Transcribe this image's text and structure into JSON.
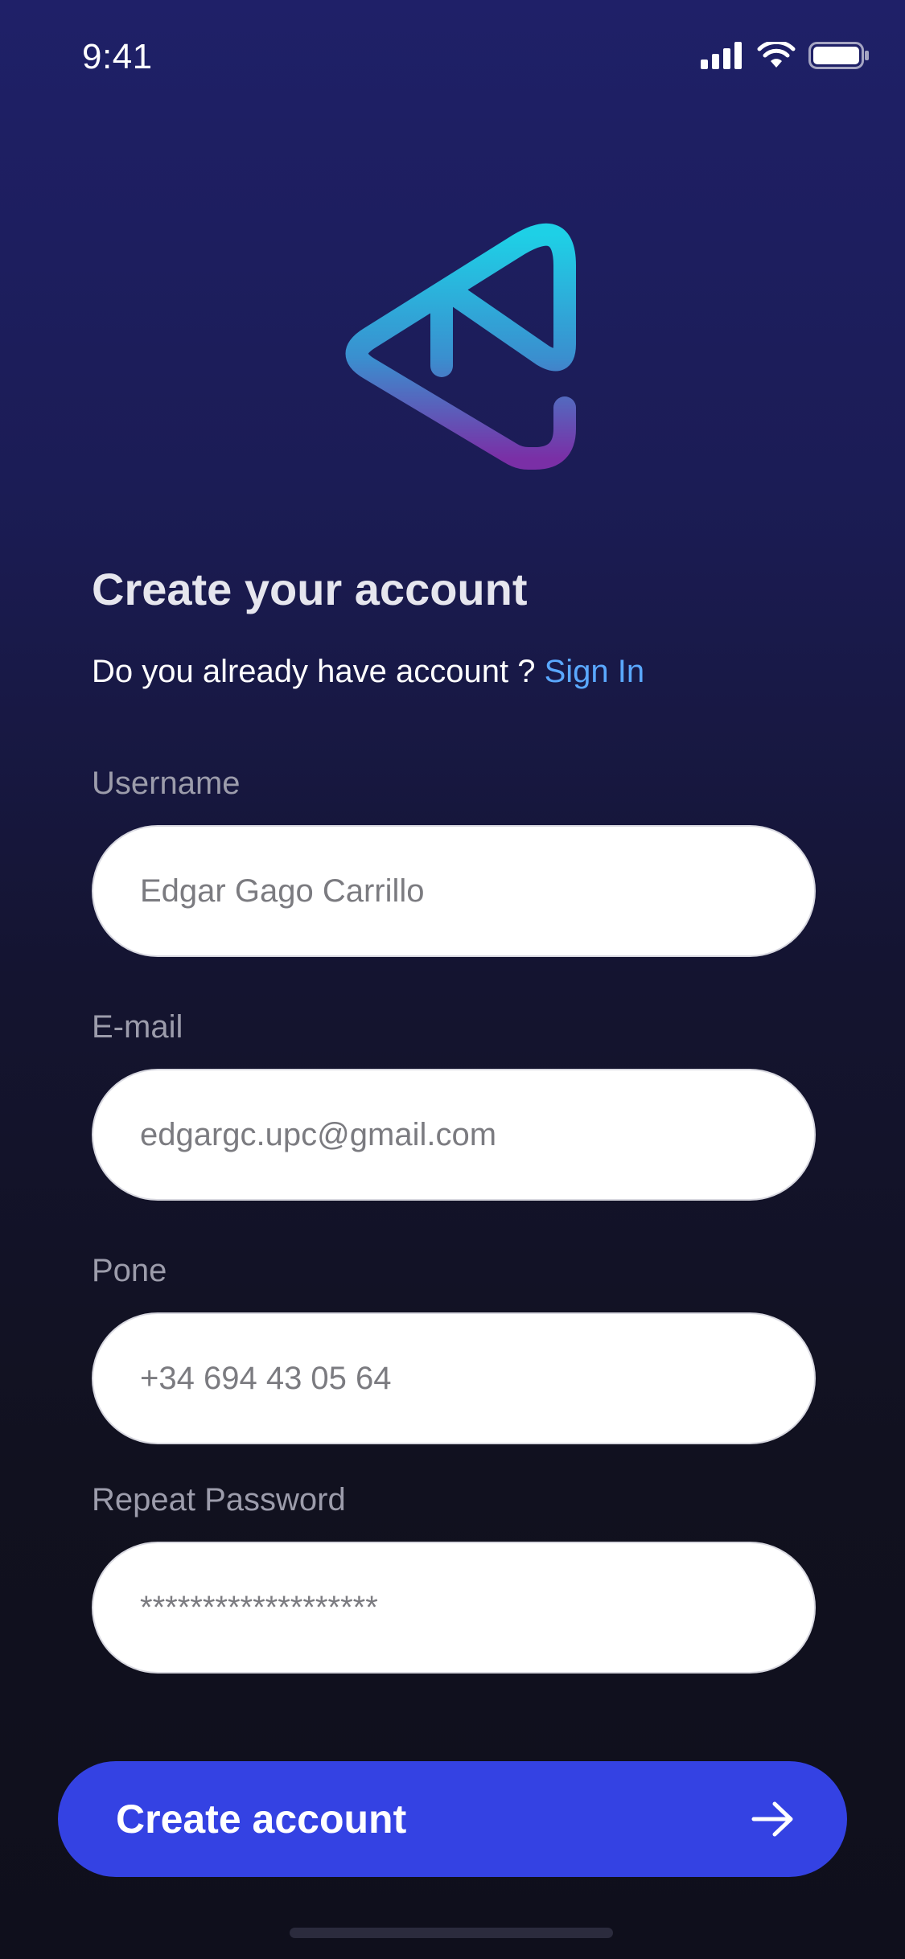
{
  "status_bar": {
    "time": "9:41"
  },
  "header": {
    "title": "Create your account",
    "prompt": "Do you already have account ?",
    "sign_in_label": "Sign In"
  },
  "form": {
    "username": {
      "label": "Username",
      "value": "Edgar Gago Carrillo"
    },
    "email": {
      "label": "E-mail",
      "value": "edgargc.upc@gmail.com"
    },
    "phone": {
      "label": "Pone",
      "value": "+34 694 43 05 64"
    },
    "repeat_password": {
      "label": "Repeat Password",
      "value": "*******************"
    }
  },
  "actions": {
    "create_account_label": "Create account"
  },
  "colors": {
    "accent": "#3442e3",
    "link": "#5aa8ff",
    "logo_top": "#1ed0e6",
    "logo_bottom": "#7a2fa6"
  },
  "icons": {
    "signal": "cellular-signal-icon",
    "wifi": "wifi-icon",
    "battery": "battery-icon",
    "arrow": "arrow-right-icon"
  }
}
